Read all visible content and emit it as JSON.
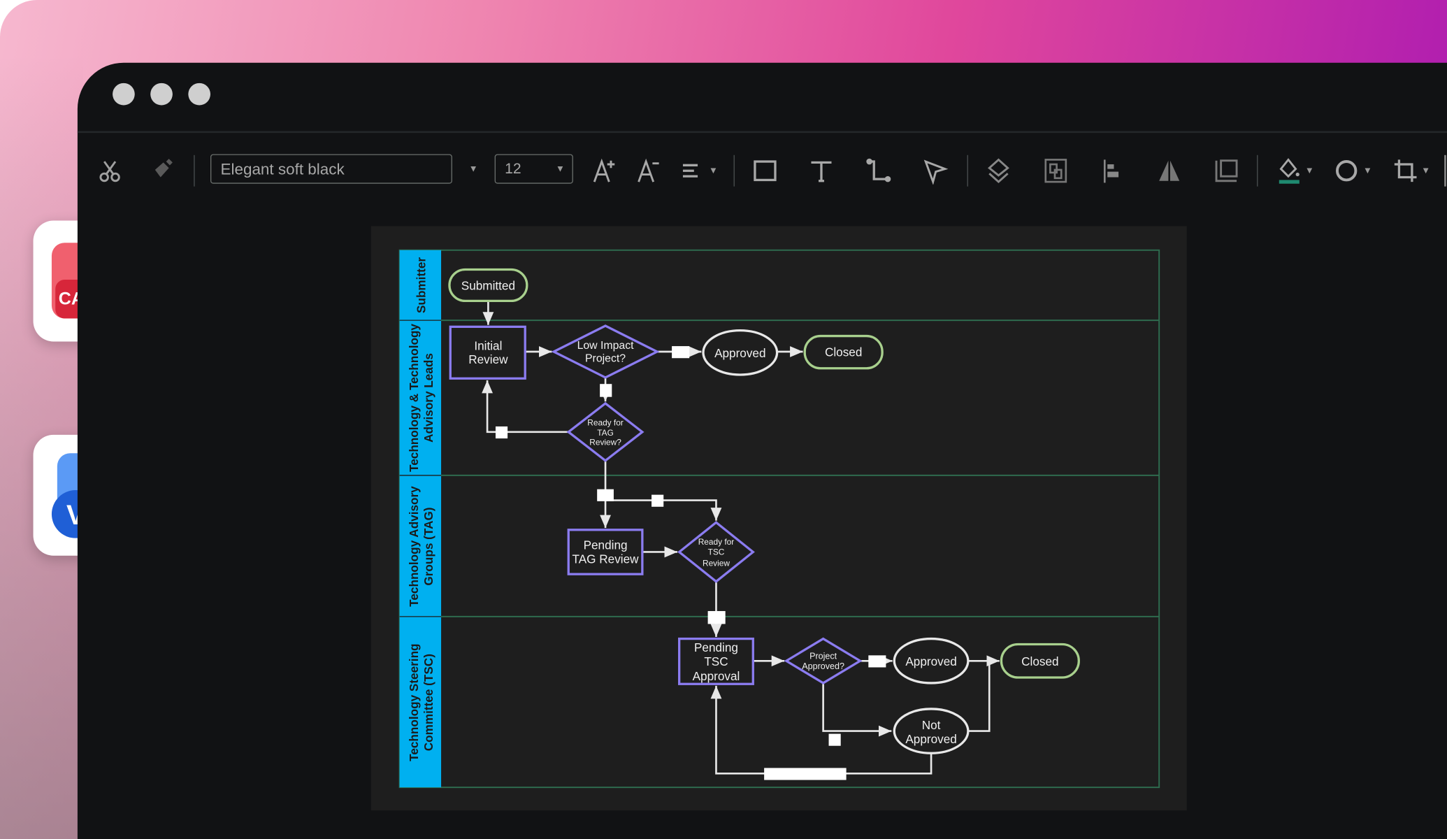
{
  "window": {
    "controls": [
      "close",
      "minimize",
      "maximize"
    ]
  },
  "toolbar": {
    "font_name": "Elegant soft black",
    "font_size": "12",
    "icons": [
      "scissors-icon",
      "format-painter-icon",
      "increase-font-icon",
      "decrease-font-icon",
      "align-icon",
      "rectangle-icon",
      "text-icon",
      "connector-icon",
      "pointer-icon",
      "layers-icon",
      "group-icon",
      "align-left-icon",
      "flip-icon",
      "frame-icon",
      "fill-icon",
      "shape-icon",
      "crop-icon"
    ],
    "fill_accent": "#1f8a70"
  },
  "apps": [
    {
      "name": "CAD",
      "label": "CAD",
      "color": "#e8394a"
    },
    {
      "name": "Visio",
      "label": "V",
      "color": "#2f6fe0"
    }
  ],
  "diagram": {
    "lanes": [
      "Submitter",
      "Technology & Technology\nAdvisory Leads",
      "Technology Advisory\nGroups (TAG)",
      "Technology Steering\nCommittee (TSC)"
    ],
    "lane_color": "#00b0f0",
    "nodes": {
      "submitted": "Submitted",
      "initial_review": [
        "Initial",
        "Review"
      ],
      "low_impact": [
        "Low Impact",
        "Project?"
      ],
      "approved1": "Approved",
      "closed1": "Closed",
      "ready_tag": [
        "Ready for",
        "TAG",
        "Review?"
      ],
      "pending_tag": [
        "Pending",
        "TAG Review"
      ],
      "ready_tsc": [
        "Ready for",
        "TSC",
        "Review"
      ],
      "pending_tsc": [
        "Pending",
        "TSC",
        "Approval"
      ],
      "project_approved": [
        "Project",
        "Approved?"
      ],
      "approved2": "Approved",
      "closed2": "Closed",
      "not_approved": [
        "Not",
        "Approved"
      ]
    },
    "colors": {
      "process": "#8b7cf0",
      "terminal": "#a8d08d",
      "ellipse": "#e8e8e8",
      "grid": "#2e6b4e"
    }
  }
}
